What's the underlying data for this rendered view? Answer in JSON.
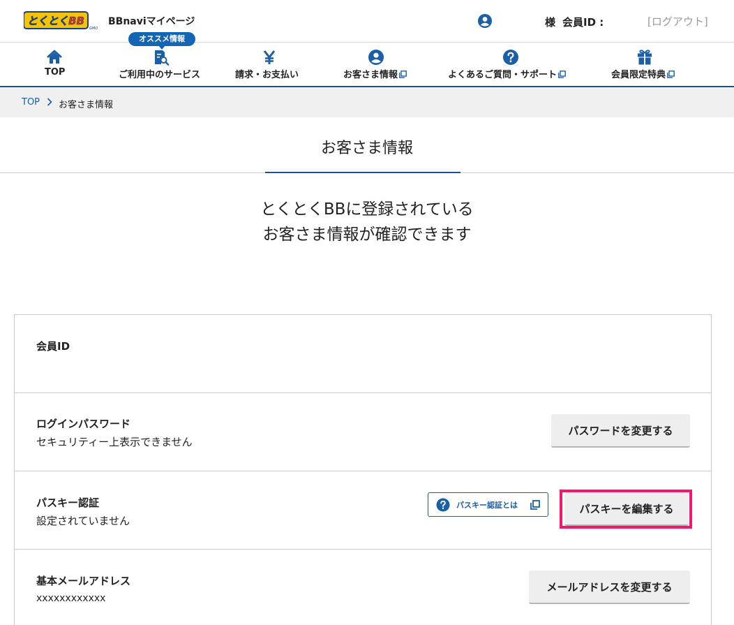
{
  "header": {
    "logo_text": "とくとくBB",
    "logo_sub": "GMO",
    "site_name": "BBnaviマイページ",
    "sama": "様",
    "member_id_label": "会員ID :",
    "logout_label": "[ログアウト]"
  },
  "nav": {
    "badge": "オススメ情報",
    "items": [
      {
        "label": "TOP",
        "icon": "home-icon"
      },
      {
        "label": "ご利用中のサービス",
        "icon": "service-search-icon"
      },
      {
        "label": "請求・お支払い",
        "icon": "yen-icon"
      },
      {
        "label": "お客さま情報",
        "icon": "person-icon",
        "external": true
      },
      {
        "label": "よくあるご質問・サポート",
        "icon": "question-icon",
        "external": true
      },
      {
        "label": "会員限定特典",
        "icon": "gift-icon",
        "external": true
      }
    ]
  },
  "breadcrumb": {
    "top": "TOP",
    "current": "お客さま情報"
  },
  "page": {
    "title": "お客さま情報",
    "lead_line1": "とくとくBBに登録されている",
    "lead_line2": "お客さま情報が確認できます"
  },
  "rows": {
    "member_id": {
      "label": "会員ID",
      "value": ""
    },
    "password": {
      "label": "ログインパスワード",
      "value": "セキュリティー上表示できません",
      "button": "パスワードを変更する"
    },
    "passkey": {
      "label": "パスキー認証",
      "value": "設定されていません",
      "help": "パスキー認証とは",
      "button": "パスキーを編集する"
    },
    "email": {
      "label": "基本メールアドレス",
      "value": "xxxxxxxxxxxx",
      "button": "メールアドレスを変更する"
    }
  },
  "colors": {
    "primary": "#1a4f94",
    "link": "#1a5fa8",
    "highlight": "#f0196d",
    "button_bg": "#eeeeee",
    "breadcrumb_bg": "#f0f0f0"
  }
}
